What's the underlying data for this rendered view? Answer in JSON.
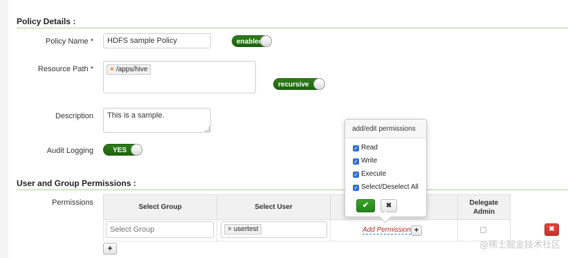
{
  "policy_details": {
    "section_title": "Policy Details :",
    "policy_name_label": "Policy Name *",
    "policy_name_value": "HDFS sample Policy",
    "enabled_toggle": "enabled",
    "resource_path_label": "Resource Path *",
    "resource_tag": "/apps/hive",
    "recursive_toggle": "recursive",
    "description_label": "Description",
    "description_value": "This is a sample.",
    "audit_logging_label": "Audit Logging",
    "audit_logging_toggle": "YES"
  },
  "permissions_section": {
    "section_title": "User and Group Permissions :",
    "permissions_label": "Permissions",
    "columns": [
      "Select Group",
      "Select User",
      "",
      "Delegate Admin"
    ],
    "select_group_placeholder": "Select Group",
    "user_tag": "usertest",
    "add_permissions_link": "Add Permissions",
    "add_permissions_plus": "+",
    "add_row_plus": "+",
    "delete_icon": "✖"
  },
  "popover": {
    "title": "add/edit permissions",
    "options": [
      "Read",
      "Write",
      "Execute",
      "Select/Deselect All"
    ],
    "ok_icon": "✔",
    "cancel_icon": "✖"
  },
  "watermark": "@稀土掘金技术社区",
  "colors": {
    "section_rule": "#a9d08e",
    "toggle_green": "#2f7d1a",
    "checkbox_blue": "#2e6fd1",
    "delete_red": "#d9534f"
  }
}
